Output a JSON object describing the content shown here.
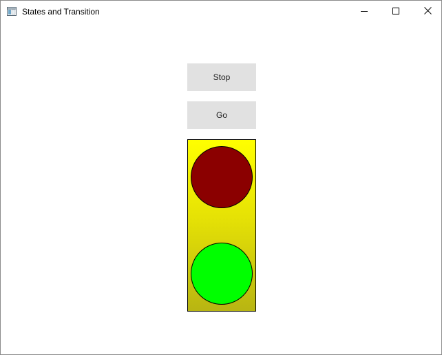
{
  "window": {
    "title": "States and Transition",
    "icon": "window-app-icon",
    "controls": [
      "minimize-icon",
      "maximize-icon",
      "close-icon"
    ]
  },
  "buttons": {
    "stop_label": "Stop",
    "go_label": "Go"
  },
  "traffic_light": {
    "housing_color_top": "#ffff00",
    "housing_color_bottom": "#b8b512",
    "red_lamp_color": "#8b0000",
    "green_lamp_color": "#00ff00"
  },
  "colors": {
    "button_background": "#e1e1e1",
    "title_bar_background": "#ffffff"
  }
}
